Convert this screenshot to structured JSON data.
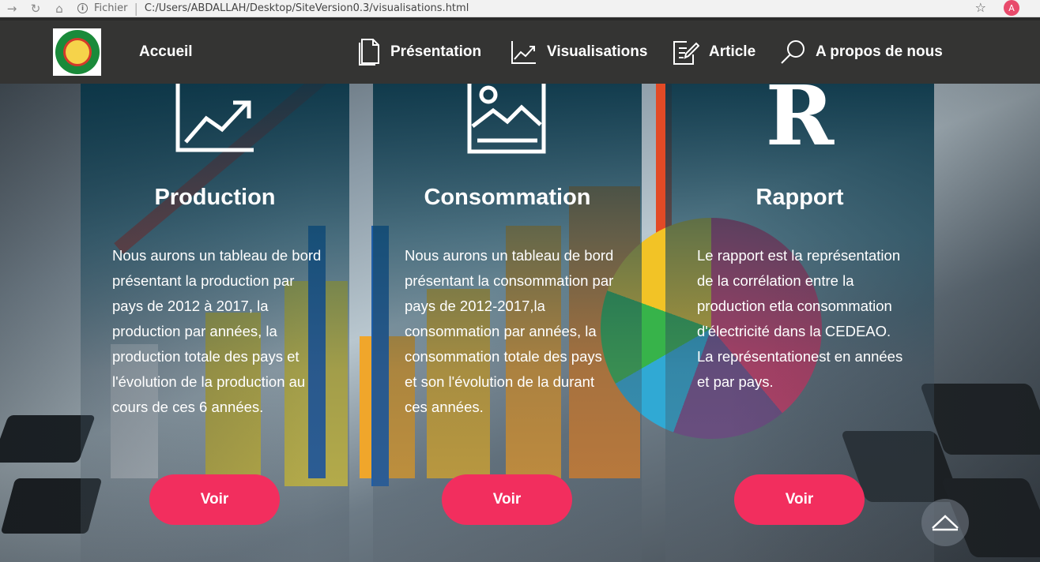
{
  "browser": {
    "back": "→",
    "reload": "↻",
    "home": "⌂",
    "info_label": "Fichier",
    "url": "C:/Users/ABDALLAH/Desktop/SiteVersion0.3/visualisations.html",
    "profile_initial": "A"
  },
  "nav": {
    "home_label": "Accueil",
    "items": [
      {
        "label": "Présentation",
        "icon": "document-icon"
      },
      {
        "label": "Visualisations",
        "icon": "chart-line-icon"
      },
      {
        "label": "Article",
        "icon": "edit-icon"
      },
      {
        "label": "A propos de nous",
        "icon": "search-icon"
      }
    ]
  },
  "cards": [
    {
      "title": "Production",
      "text": "Nous aurons un tableau de bord présentant la production par pays de 2012 à 2017, la production par années, la production totale des pays et l'évolution de la production au cours de ces 6 années.",
      "button": "Voir",
      "icon": "chart-line-icon"
    },
    {
      "title": "Consommation",
      "text": "Nous aurons un tableau de bord présentant la consommation par pays de 2012-2017,la consommation par années, la consommation totale des pays et son l'évolution de la durant ces années.",
      "button": "Voir",
      "icon": "image-icon"
    },
    {
      "title": "Rapport",
      "text": "Le rapport est la représentation de la corrélation entre la production etla consommation d'électricité dans la CEDEAO. La représentationest en années et par pays.",
      "button": "Voir",
      "icon": "r-logo-icon",
      "icon_text": "R"
    }
  ],
  "colors": {
    "navbar": "#343433",
    "button": "#f22e5e",
    "card_top": "#083446"
  }
}
